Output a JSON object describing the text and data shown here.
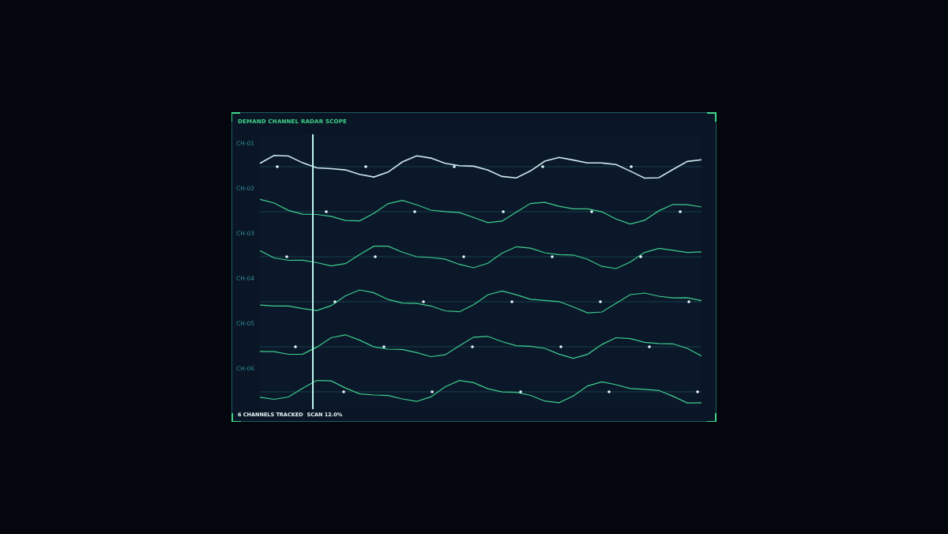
{
  "title": "DEMAND CHANNEL RADAR SCOPE",
  "channels": [
    {
      "label": "CH-01",
      "selected": true
    },
    {
      "label": "CH-02",
      "selected": false
    },
    {
      "label": "CH-03",
      "selected": false
    },
    {
      "label": "CH-04",
      "selected": false
    },
    {
      "label": "CH-05",
      "selected": false
    },
    {
      "label": "CH-06",
      "selected": false
    }
  ],
  "scan": {
    "level": 0.12
  },
  "footer": {
    "tracked": "6 CHANNELS TRACKED",
    "scan": "SCAN 12.0%"
  }
}
